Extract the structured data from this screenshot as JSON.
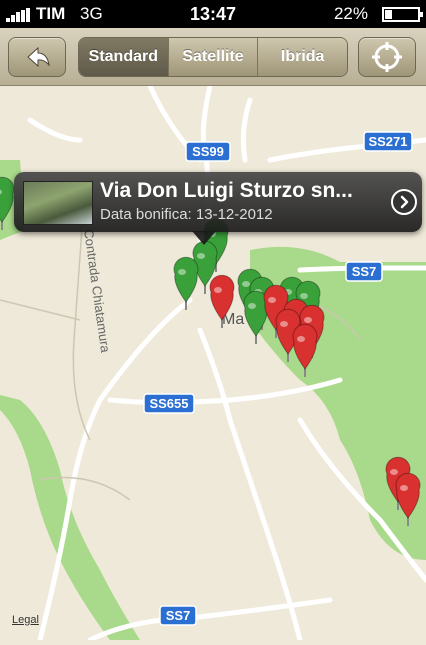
{
  "status_bar": {
    "carrier": "TIM",
    "network": "3G",
    "time": "13:47",
    "battery_text": "22%",
    "battery_level": 0.22
  },
  "toolbar": {
    "back_icon": "back-arrow-icon",
    "segments": [
      {
        "label": "Standard",
        "active": true
      },
      {
        "label": "Satellite",
        "active": false
      },
      {
        "label": "Ibrida",
        "active": false
      }
    ],
    "locate_icon": "crosshair-icon"
  },
  "map": {
    "road_labels": [
      "SS99",
      "SS271",
      "SS7",
      "SS655",
      "SS7"
    ],
    "place_labels": [
      "Contrada Chiatamura",
      "Ma"
    ],
    "legal": "Legal"
  },
  "callout": {
    "title": "Via Don Luigi Sturzo sn...",
    "subtitle": "Data bonifica: 13-12-2012",
    "disclosure_icon": "chevron-right-icon"
  },
  "colors": {
    "pin_green": "#3aa03a",
    "pin_red": "#d93030",
    "park_green": "#a9d98a",
    "land": "#efe9d9",
    "road_shield": "#2a6fd1"
  }
}
